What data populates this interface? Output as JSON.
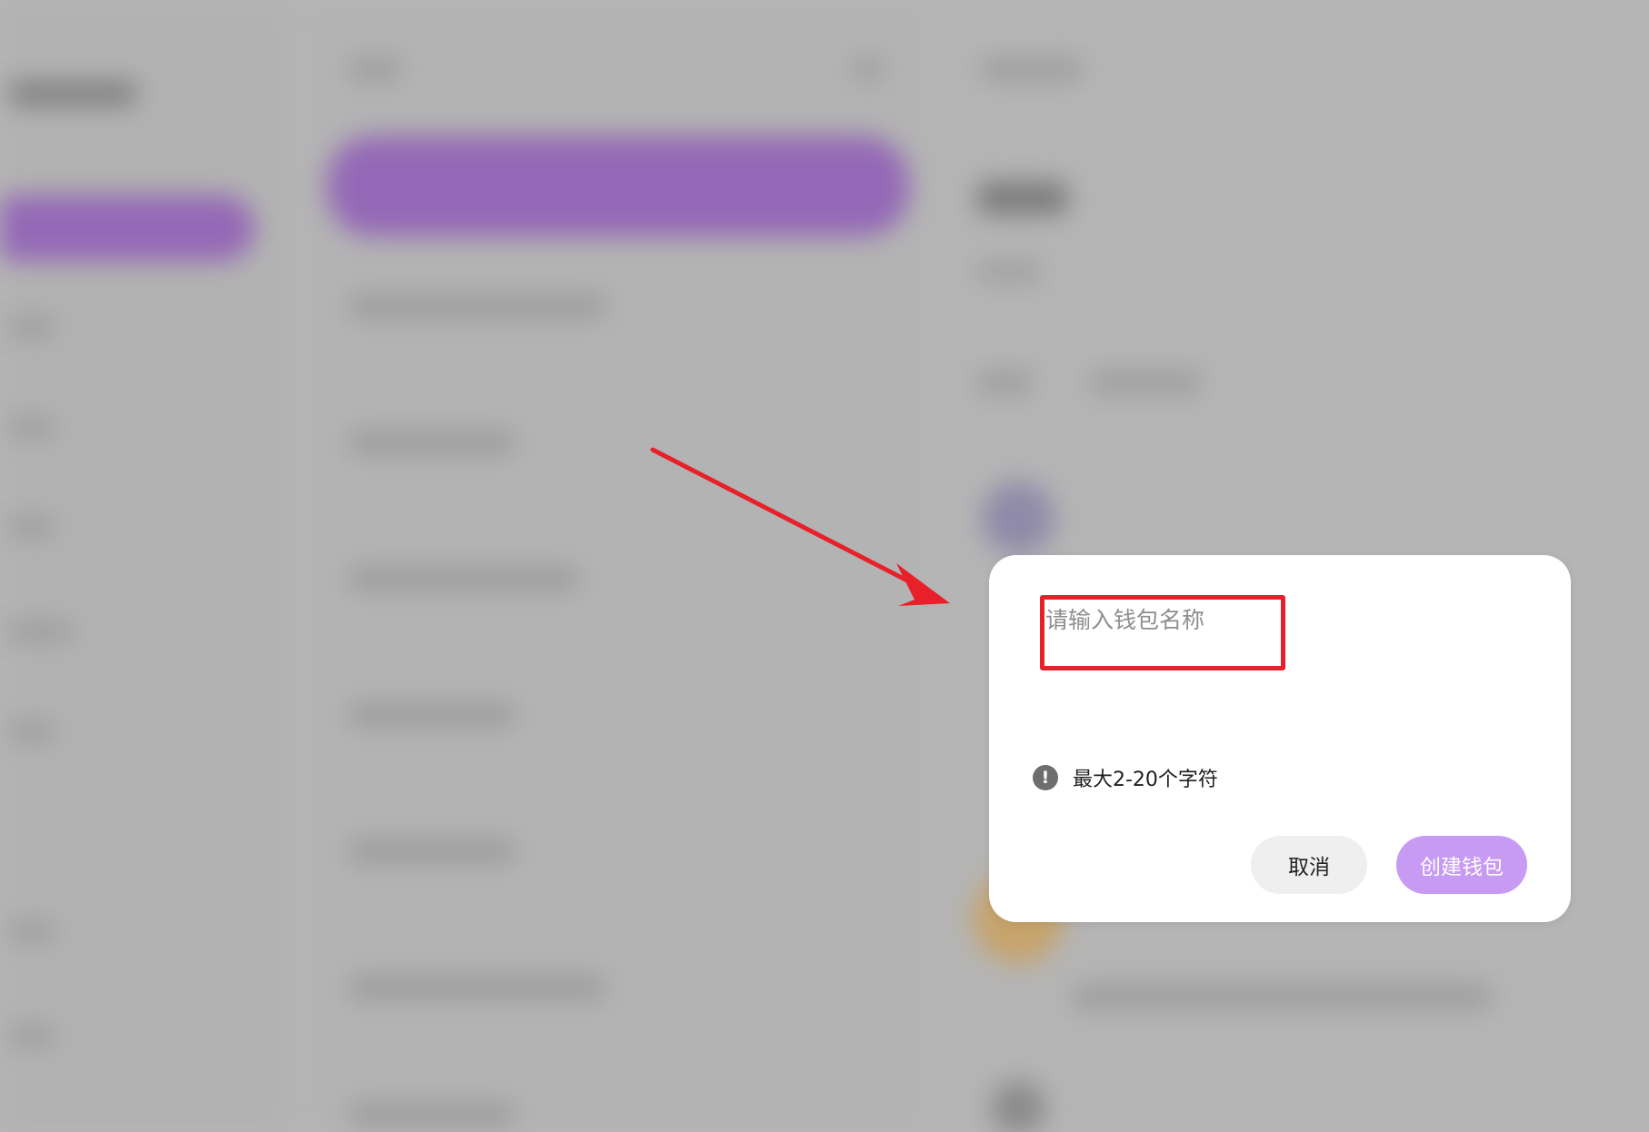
{
  "dialog": {
    "input_placeholder": "请输入钱包名称",
    "input_value": "",
    "hint_icon": "!",
    "hint_text": "最大2-20个字符",
    "cancel_label": "取消",
    "create_label": "创建钱包"
  },
  "colors": {
    "overlay": "#b5b5b5",
    "accent_purple": "#9468b6",
    "create_button": "#c79af4",
    "highlight_red": "#e8202a"
  },
  "icons": {
    "hint": "exclamation-circle-icon",
    "annotation": "red-arrow-icon"
  }
}
